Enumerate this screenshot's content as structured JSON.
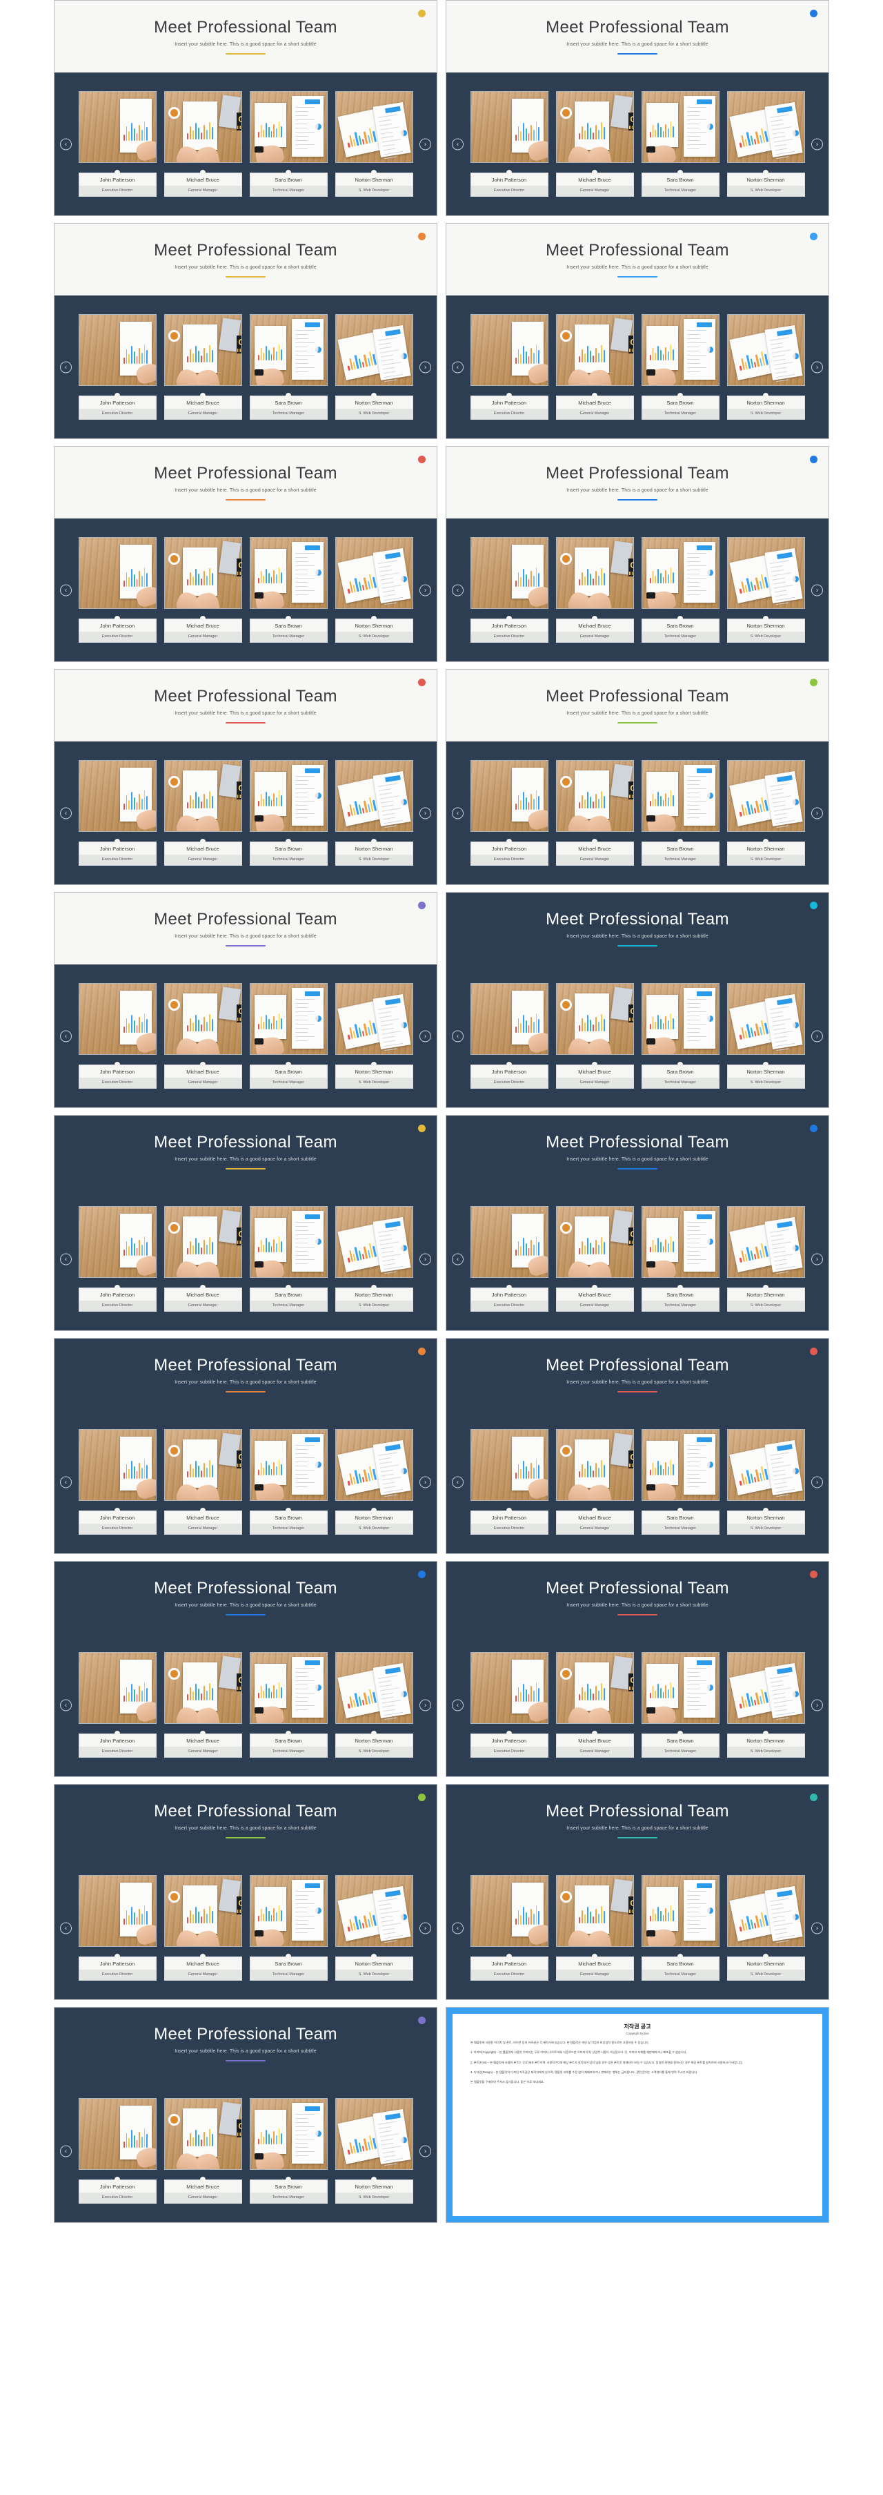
{
  "deck": {
    "title": "Meet Professional Team",
    "subtitle": "Insert your subtitle here. This is a good space for a short subtitle",
    "nav": {
      "prev": "‹",
      "next": "›"
    }
  },
  "team": [
    {
      "name": "John Patterson",
      "role": "Executive Director"
    },
    {
      "name": "Michael Bruce",
      "role": "General Manager"
    },
    {
      "name": "Sara Brown",
      "role": "Technical Manager"
    },
    {
      "name": "Norton Sherman",
      "role": "S. Web Developer"
    }
  ],
  "palette": {
    "navy": "#2d3e52",
    "light_header": "#f7f7f5",
    "gold": "#e2b93b",
    "blue": "#1f7ae0",
    "orange": "#e8853a",
    "sky": "#3aa0f5",
    "red": "#e05b4f",
    "green": "#8cc63f",
    "purple": "#7b72c9",
    "cyan": "#18b6d8",
    "teal": "#2fb8b0"
  },
  "slides": [
    {
      "index": 1,
      "header": "light",
      "accent": "#e2b93b",
      "rule": "#e2b93b"
    },
    {
      "index": 2,
      "header": "light",
      "accent": "#1f7ae0",
      "rule": "#1f7ae0"
    },
    {
      "index": 3,
      "header": "light",
      "accent": "#e8853a",
      "rule": "#e2b93b"
    },
    {
      "index": 4,
      "header": "light",
      "accent": "#3aa0f5",
      "rule": "#3aa0f5"
    },
    {
      "index": 5,
      "header": "light",
      "accent": "#e05b4f",
      "rule": "#e8853a"
    },
    {
      "index": 6,
      "header": "light",
      "accent": "#1f7ae0",
      "rule": "#1f7ae0"
    },
    {
      "index": 7,
      "header": "light",
      "accent": "#e05b4f",
      "rule": "#e05b4f"
    },
    {
      "index": 8,
      "header": "light",
      "accent": "#8cc63f",
      "rule": "#8cc63f"
    },
    {
      "index": 9,
      "header": "light",
      "accent": "#7b72c9",
      "rule": "#7b72c9"
    },
    {
      "index": 10,
      "header": "dark",
      "accent": "#18b6d8",
      "rule": "#18b6d8"
    },
    {
      "index": 11,
      "header": "dark",
      "accent": "#e2b93b",
      "rule": "#e2b93b"
    },
    {
      "index": 12,
      "header": "dark",
      "accent": "#1f7ae0",
      "rule": "#1f7ae0"
    },
    {
      "index": 13,
      "header": "dark",
      "accent": "#e8853a",
      "rule": "#e8853a"
    },
    {
      "index": 14,
      "header": "dark",
      "accent": "#e05b4f",
      "rule": "#e05b4f"
    },
    {
      "index": 15,
      "header": "dark",
      "accent": "#1f7ae0",
      "rule": "#1f7ae0"
    },
    {
      "index": 16,
      "header": "dark",
      "accent": "#e05b4f",
      "rule": "#e05b4f"
    },
    {
      "index": 17,
      "header": "dark",
      "accent": "#8cc63f",
      "rule": "#8cc63f"
    },
    {
      "index": 18,
      "header": "dark",
      "accent": "#2fb8b0",
      "rule": "#2fb8b0"
    },
    {
      "index": 19,
      "header": "dark",
      "accent": "#7b72c9",
      "rule": "#7b72c9"
    }
  ],
  "copyright_slide": {
    "title": "저작권 공고",
    "subtitle": "Copyright Notice",
    "paragraphs": [
      "본 템플릿에 사용된 이미지 및 폰트, 아이콘 등의 저작권은 각 제작사에 있습니다. 본 템플릿은 개인 및 기업의 비상업적 용도로만 사용하실 수 있습니다.",
      "1. 이미지(Copyright) – 본 템플릿에 사용된 이미지는 무료 이미지 사이트에서 다운로드한 이미지이며, 상업적 사용이 가능합니다. 단, 이미지 자체를 재판매하거나 배포할 수 없습니다.",
      "2. 폰트(Font) – 본 템플릿에 사용된 폰트는 무료 배포 폰트이며, 사용자 PC에 해당 폰트가 설치되어 있지 않을 경우 다른 폰트로 대체되어 보일 수 있습니다. 동일한 화면을 원하시는 경우 해당 폰트를 설치하여 사용하시기 바랍니다.",
      "3. 디자인(Design) – 본 템플릿의 디자인 저작권은 제작자에게 있으며, 템플릿 자체를 수정 없이 재배포하거나 판매하는 행위는 금지됩니다. 관련 문의는 고객센터를 통해 연락 주시기 바랍니다.",
      "본 템플릿을 구매하여 주셔서 감사합니다. 좋은 하루 보내세요."
    ]
  }
}
